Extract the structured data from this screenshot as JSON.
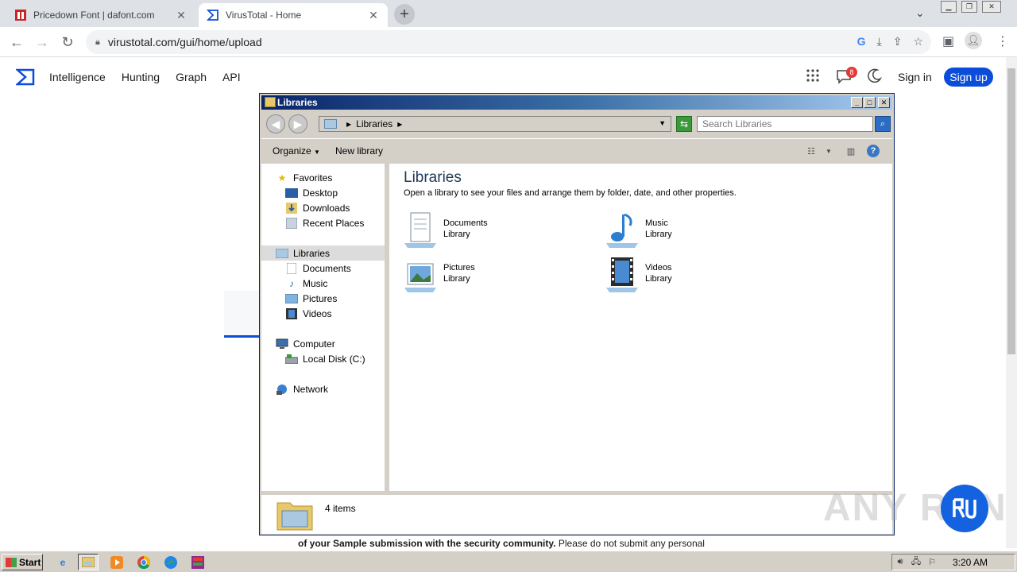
{
  "browser": {
    "tabs": [
      {
        "title": "Pricedown Font | dafont.com",
        "active": false
      },
      {
        "title": "VirusTotal - Home",
        "active": true
      }
    ],
    "url": "virustotal.com/gui/home/upload"
  },
  "vt": {
    "nav": [
      "Intelligence",
      "Hunting",
      "Graph",
      "API"
    ],
    "notification_count": "8",
    "signin": "Sign in",
    "signup": "Sign up",
    "bottom_text_bold": "of your Sample submission with the security community.",
    "bottom_text_rest": " Please do not submit any personal"
  },
  "explorer": {
    "title": "Libraries",
    "address": "Libraries",
    "search_placeholder": "Search Libraries",
    "commands": {
      "organize": "Organize",
      "new_library": "New library"
    },
    "nav": {
      "favorites": "Favorites",
      "favorites_items": [
        "Desktop",
        "Downloads",
        "Recent Places"
      ],
      "libraries": "Libraries",
      "libraries_items": [
        "Documents",
        "Music",
        "Pictures",
        "Videos"
      ],
      "computer": "Computer",
      "computer_items": [
        "Local Disk (C:)"
      ],
      "network": "Network"
    },
    "content": {
      "heading": "Libraries",
      "description": "Open a library to see your files and arrange them by folder, date, and other properties.",
      "items": [
        {
          "name": "Documents",
          "type": "Library",
          "icon": "documents-library-icon"
        },
        {
          "name": "Music",
          "type": "Library",
          "icon": "music-library-icon"
        },
        {
          "name": "Pictures",
          "type": "Library",
          "icon": "pictures-library-icon"
        },
        {
          "name": "Videos",
          "type": "Library",
          "icon": "videos-library-icon"
        }
      ]
    },
    "status": "4 items"
  },
  "taskbar": {
    "start": "Start",
    "clock": "3:20 AM"
  },
  "watermark": "ANY RUN"
}
